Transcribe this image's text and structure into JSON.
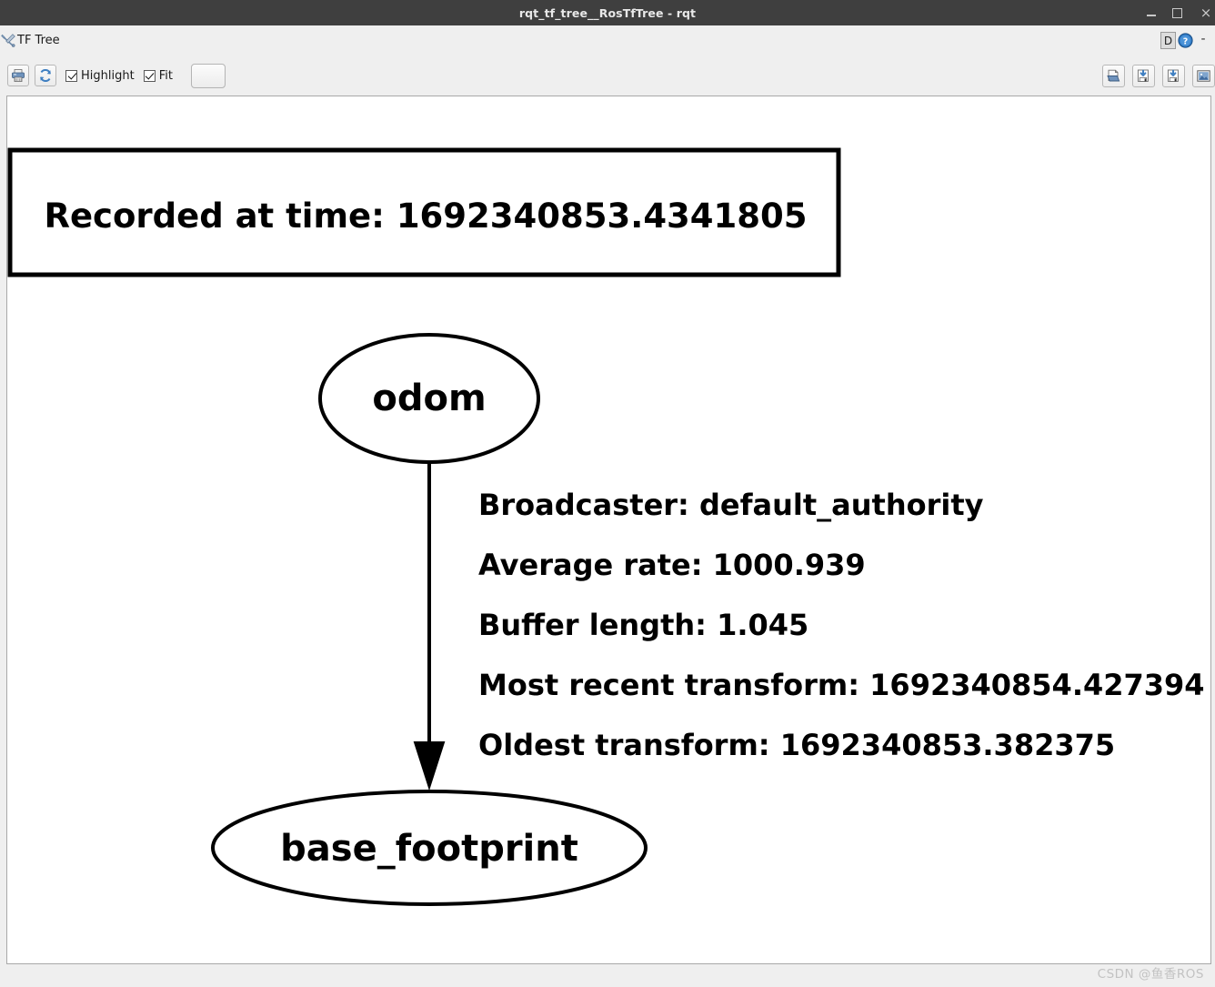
{
  "window": {
    "title": "rqt_tf_tree__RosTfTree - rqt",
    "controls": {
      "minimize": "minimize-icon",
      "maximize": "maximize-icon",
      "close": "×"
    }
  },
  "plugin": {
    "icon": "wrench-screwdriver-icon",
    "title": "TF Tree",
    "dock_label": "D",
    "help_label": "?",
    "close_label": "-"
  },
  "toolbar": {
    "refresh_icon": "refresh-icon",
    "save_dot_icon": "printer-icon",
    "highlight": {
      "label": "Highlight",
      "checked": true
    },
    "fit": {
      "label": "Fit",
      "checked": true
    },
    "combo_value": "",
    "right_buttons": [
      {
        "name": "load-dot-button",
        "icon": "folder-open-icon"
      },
      {
        "name": "save-as-dot-button",
        "icon": "save-down-icon"
      },
      {
        "name": "save-as-svg-button",
        "icon": "save-down-icon"
      },
      {
        "name": "save-as-image-button",
        "icon": "image-icon"
      }
    ]
  },
  "graph": {
    "recorded_at": "Recorded at time: 1692340853.4341805",
    "nodes": [
      {
        "id": "odom",
        "label": "odom"
      },
      {
        "id": "base_footprint",
        "label": "base_footprint"
      }
    ],
    "edge": {
      "from": "odom",
      "to": "base_footprint",
      "lines": [
        "Broadcaster: default_authority",
        "Average rate: 1000.939",
        "Buffer length: 1.045",
        "Most recent transform: 1692340854.427394",
        "Oldest transform: 1692340853.382375"
      ]
    }
  },
  "watermark": "CSDN @鱼香ROS",
  "colors": {
    "titlebar_bg": "#3f3f3f",
    "chrome_bg": "#efefef",
    "canvas_bg": "#ffffff",
    "graph_stroke": "#000000",
    "accent_blue": "#2d6cab"
  }
}
